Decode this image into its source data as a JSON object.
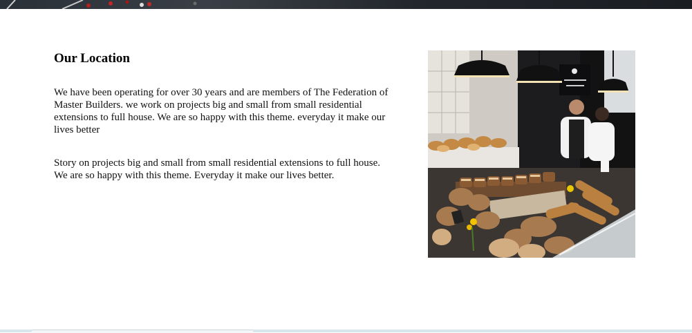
{
  "location": {
    "heading": "Our Location",
    "paragraph_1": "We have been operating for over 30 years and are members of The Federation of Master Builders. we work on projects big and small from small residential extensions to full house. We are so happy with this theme. everyday it make our lives better",
    "paragraph_2": "Story on projects big and small from small residential extensions to full house. We are so happy with this theme. Everyday it make our lives better."
  },
  "colors": {
    "banner": "#2a3038",
    "text": "#111111",
    "bottom_bar": "#d8e6ee"
  }
}
